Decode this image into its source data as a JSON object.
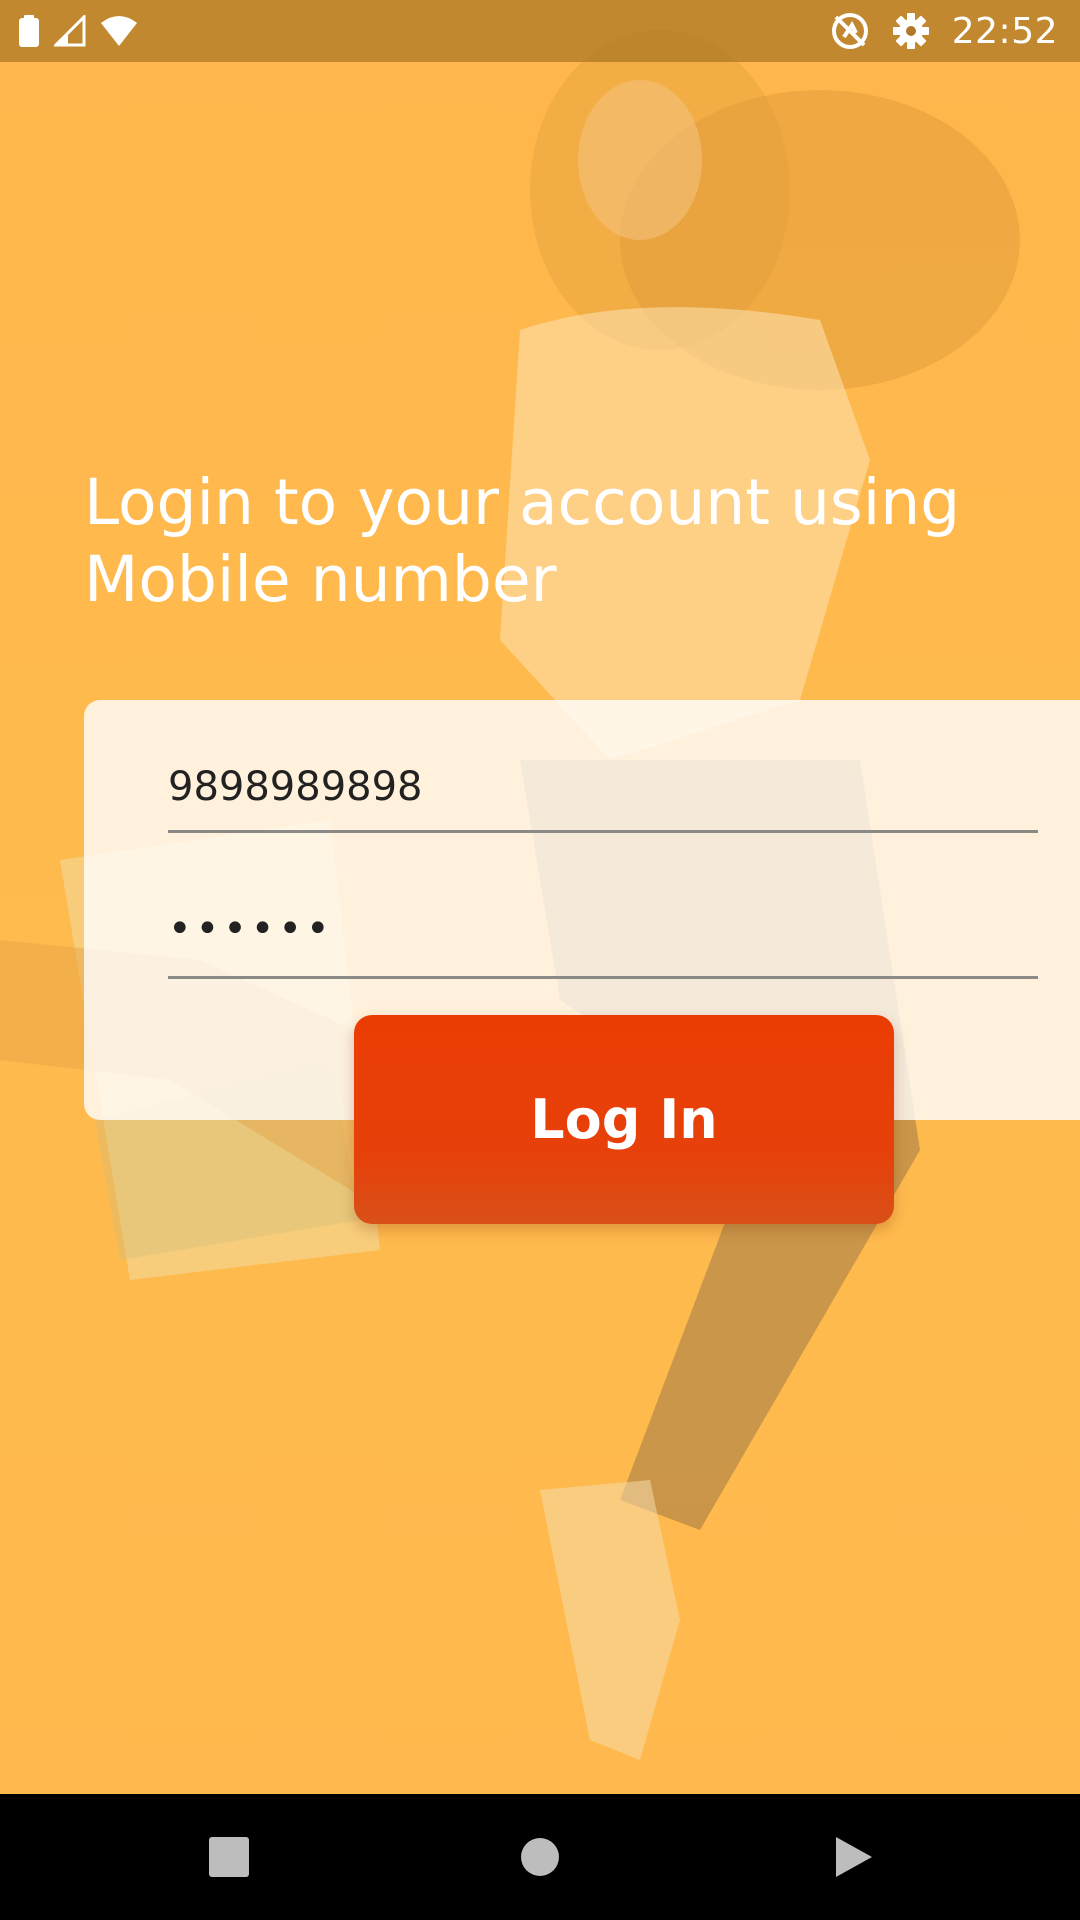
{
  "status_bar": {
    "time": "22:52",
    "icons": [
      "battery-icon",
      "signal-icon",
      "wifi-icon",
      "sync-off-icon",
      "gear-icon"
    ]
  },
  "login": {
    "heading": "Login to your account using Mobile number",
    "phone_value": "9898989898",
    "password_value": "••••••",
    "button_label": "Log In"
  },
  "nav_bar": {
    "icons": [
      "recents-icon",
      "home-icon",
      "back-icon"
    ]
  },
  "colors": {
    "background": "#ffb84d",
    "button": "#e83d05",
    "card": "#fdf6ec",
    "status_bar": "#b07a2a"
  }
}
